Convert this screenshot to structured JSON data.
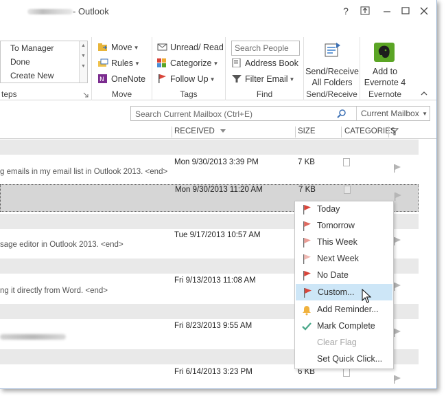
{
  "window": {
    "title": "- Outlook"
  },
  "window_controls": {
    "help": "?",
    "restore_ribbon": "⧉",
    "minimize": "—",
    "maximize": "☐",
    "close": "✕"
  },
  "ribbon": {
    "quick_steps": {
      "items": [
        "To Manager",
        "Done",
        "Create New"
      ],
      "label": "teps"
    },
    "move": {
      "move": "Move",
      "rules": "Rules",
      "onenote": "OneNote",
      "label": "Move"
    },
    "tags": {
      "unread_read": "Unread/ Read",
      "categorize": "Categorize",
      "follow_up": "Follow Up",
      "label": "Tags"
    },
    "find": {
      "search_people_placeholder": "Search People",
      "address_book": "Address Book",
      "filter_email": "Filter Email",
      "label": "Find"
    },
    "send_receive": {
      "button_line1": "Send/Receive",
      "button_line2": "All Folders",
      "label": "Send/Receive"
    },
    "evernote": {
      "button_line1": "Add to",
      "button_line2": "Evernote 4",
      "label": "Evernote"
    }
  },
  "search": {
    "placeholder": "Search Current Mailbox (Ctrl+E)",
    "scope": "Current Mailbox"
  },
  "columns": {
    "received": "RECEIVED",
    "size": "SIZE",
    "categories": "CATEGORIES"
  },
  "messages": [
    {
      "preview": "g emails in my email list in Outlook 2013. <end>",
      "received": "Mon 9/30/2013 3:39 PM",
      "size": "7 KB"
    },
    {
      "preview": "",
      "received": "Mon 9/30/2013 11:20 AM",
      "size": "7 KB"
    },
    {
      "preview": "sage editor in Outlook 2013. <end>",
      "received": "Tue 9/17/2013 10:57 AM",
      "size": ""
    },
    {
      "preview": "ng it directly from Word. <end>",
      "received": "Fri 9/13/2013 11:08 AM",
      "size": ""
    },
    {
      "preview": "",
      "received": "Fri 8/23/2013 9:55 AM",
      "size": ""
    },
    {
      "preview": "",
      "received": "Fri 6/14/2013 3:23 PM",
      "size": "6 KB"
    }
  ],
  "context_menu": {
    "items": [
      "Today",
      "Tomorrow",
      "This Week",
      "Next Week",
      "No Date",
      "Custom...",
      "Add Reminder...",
      "Mark Complete",
      "Clear Flag",
      "Set Quick Click..."
    ]
  },
  "colors": {
    "accent_flag": "#d9453a",
    "highlight": "#cde6f7",
    "evernote": "#5ba525",
    "group_header": "#e9e9e9"
  }
}
